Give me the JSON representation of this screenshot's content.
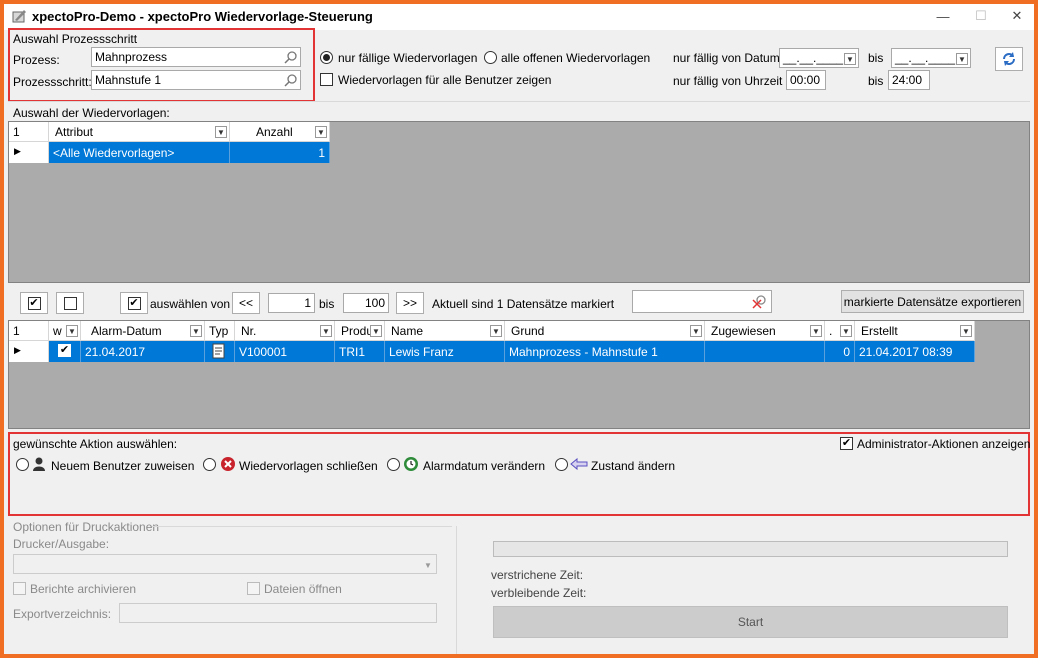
{
  "window": {
    "title": "xpectoPro-Demo - xpectoPro Wiedervorlage-Steuerung"
  },
  "process_group": {
    "title": "Auswahl Prozessschritt",
    "process_label": "Prozess:",
    "process_value": "Mahnprozess",
    "step_label": "Prozessschritt:",
    "step_value": "Mahnstufe 1"
  },
  "filters": {
    "radio_due": "nur fällige Wiedervorlagen",
    "radio_all_open": "alle offenen Wiedervorlagen",
    "check_all_users": "Wiedervorlagen für alle Benutzer zeigen",
    "due_from_date_label": "nur fällig von Datum",
    "date_from_value": "__.__.____",
    "date_to_value": "__.__.____",
    "bis1": "bis",
    "due_from_time_label": "nur fällig von Uhrzeit",
    "time_from_value": "00:00",
    "bis2": "bis",
    "time_to_value": "24:00"
  },
  "selection": {
    "label": "Auswahl der Wiedervorlagen:",
    "corner": "1",
    "columns": [
      "Attribut",
      "Anzahl"
    ],
    "rows": [
      [
        "<Alle Wiedervorlagen>",
        "1"
      ]
    ]
  },
  "toolbar": {
    "select_from_label": "auswählen von",
    "prev_label": "<<",
    "from_value": "1",
    "bis": "bis",
    "to_value": "100",
    "next_label": ">>",
    "marked_status": "Aktuell sind 1 Datensätze markiert",
    "export_label": "markierte Datensätze exportieren"
  },
  "records": {
    "corner": "1",
    "columns": [
      "w",
      "Alarm-Datum",
      "Typ",
      "Nr.",
      "Produ",
      "Name",
      "Grund",
      "Zugewiesen",
      ".",
      "Erstellt"
    ],
    "rows": [
      [
        "",
        "21.04.2017",
        "",
        "V100001",
        "TRI1",
        "Lewis Franz",
        "Mahnprozess - Mahnstufe 1",
        "",
        "0",
        "21.04.2017 08:39"
      ]
    ]
  },
  "actions": {
    "label": "gewünschte Aktion auswählen:",
    "admin_label": "Administrator-Aktionen anzeigen",
    "assign_user": "Neuem Benutzer zuweisen",
    "close": "Wiedervorlagen schließen",
    "alarm_date": "Alarmdatum verändern",
    "state": "Zustand ändern"
  },
  "print": {
    "title": "Optionen für Druckaktionen",
    "printer_label": "Drucker/Ausgabe:",
    "archive_label": "Berichte archivieren",
    "open_files_label": "Dateien öffnen",
    "export_dir_label": "Exportverzeichnis:",
    "elapsed_label": "verstrichene Zeit:",
    "remaining_label": "verbleibende Zeit:",
    "start_label": "Start"
  },
  "colors": {
    "accent": "#0078d7",
    "frame": "#f06e23",
    "highlight": "#e23434",
    "grid_bg": "#ababab"
  }
}
